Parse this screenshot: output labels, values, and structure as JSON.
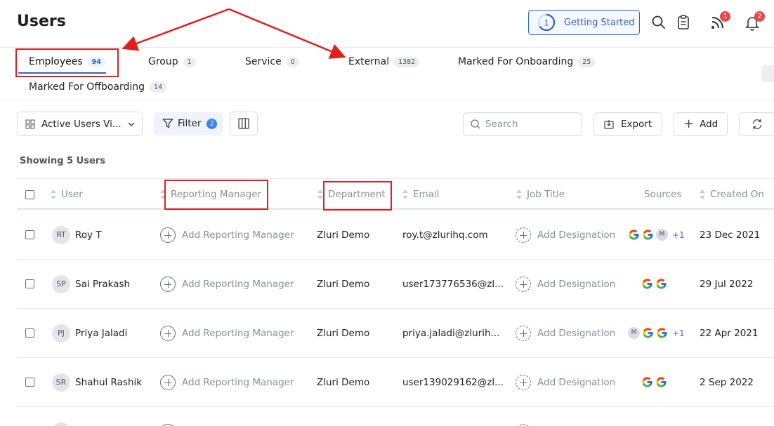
{
  "header": {
    "title": "Users",
    "getting_started": {
      "label": "Getting Started",
      "step": "1"
    },
    "icons": {
      "search": "search-icon",
      "clipboard": "clipboard-icon",
      "feed": {
        "icon": "rss-icon",
        "badge": "1"
      },
      "notifications": {
        "icon": "bell-icon",
        "badge": "2"
      }
    }
  },
  "tabs": [
    {
      "label": "Employees",
      "count": "94",
      "active": true
    },
    {
      "label": "Group",
      "count": "1"
    },
    {
      "label": "Service",
      "count": "0"
    },
    {
      "label": "External",
      "count": "1382"
    },
    {
      "label": "Marked For Onboarding",
      "count": "25"
    },
    {
      "label": "Marked For Offboarding",
      "count": "14"
    }
  ],
  "toolbar": {
    "view_select": "Active Users Vi...",
    "filter": {
      "label": "Filter",
      "count": "2"
    },
    "search_placeholder": "Search",
    "export": "Export",
    "add": "Add"
  },
  "table": {
    "showing": "Showing 5 Users",
    "columns": [
      "User",
      "Reporting Manager",
      "Department",
      "Email",
      "Job Title",
      "Sources",
      "Created On"
    ],
    "rows": [
      {
        "initials": "RT",
        "name": "Roy T",
        "manager": "Add Reporting Manager",
        "department": "Zluri Demo",
        "email": "roy.t@zlurihq.com",
        "job_title": "Add Designation",
        "sources": [
          "G",
          "G",
          "M"
        ],
        "more": "+1",
        "created": "23 Dec 2021"
      },
      {
        "initials": "SP",
        "name": "Sai Prakash",
        "manager": "Add Reporting Manager",
        "department": "Zluri Demo",
        "email": "user173776536@zl...",
        "job_title": "Add Designation",
        "sources": [
          "G",
          "G"
        ],
        "more": "",
        "created": "29 Jul 2022"
      },
      {
        "initials": "PJ",
        "name": "Priya Jaladi",
        "manager": "Add Reporting Manager",
        "department": "Zluri Demo",
        "email": "priya.jaladi@zlurih...",
        "job_title": "Add Designation",
        "sources": [
          "M",
          "G",
          "G"
        ],
        "more": "+1",
        "created": "22 Apr 2021"
      },
      {
        "initials": "SR",
        "name": "Shahul Rashik",
        "manager": "Add Reporting Manager",
        "department": "Zluri Demo",
        "email": "user139029162@zl...",
        "job_title": "Add Designation",
        "sources": [
          "G",
          "G"
        ],
        "more": "",
        "created": "2 Sep 2022"
      }
    ]
  },
  "annotation": {
    "color": "#e02020"
  },
  "colors": {
    "accent": "#2c62c9",
    "badge": "#e5484d",
    "google_blue": "#4285F4",
    "google_red": "#EA4335",
    "google_yellow": "#FBBC05",
    "google_green": "#34A853"
  }
}
